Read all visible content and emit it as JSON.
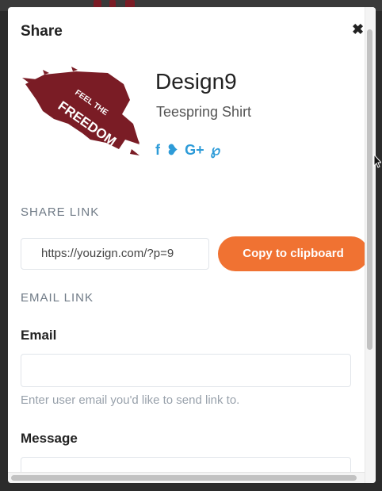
{
  "dialog": {
    "title": "Share",
    "close_icon": "close-icon"
  },
  "design": {
    "image_text_1": "FEEL THE",
    "image_text_2": "FREEDOM",
    "title": "Design9",
    "subtitle": "Teespring Shirt",
    "social": [
      {
        "icon": "facebook-icon",
        "glyph": "f"
      },
      {
        "icon": "twitter-icon",
        "glyph": "❥"
      },
      {
        "icon": "google-plus-icon",
        "glyph": "G+"
      },
      {
        "icon": "pinterest-icon",
        "glyph": "℘"
      }
    ]
  },
  "share_link": {
    "label": "SHARE LINK",
    "value": "https://youzign.com/?p=9",
    "copy_label": "Copy to clipboard"
  },
  "email_link": {
    "label": "EMAIL LINK",
    "email_label": "Email",
    "email_value": "",
    "help": "Enter user email you'd like to send link to.",
    "message_label": "Message"
  },
  "colors": {
    "accent": "#f07232",
    "social": "#2d9bd8",
    "design_red": "#7a1c25"
  }
}
